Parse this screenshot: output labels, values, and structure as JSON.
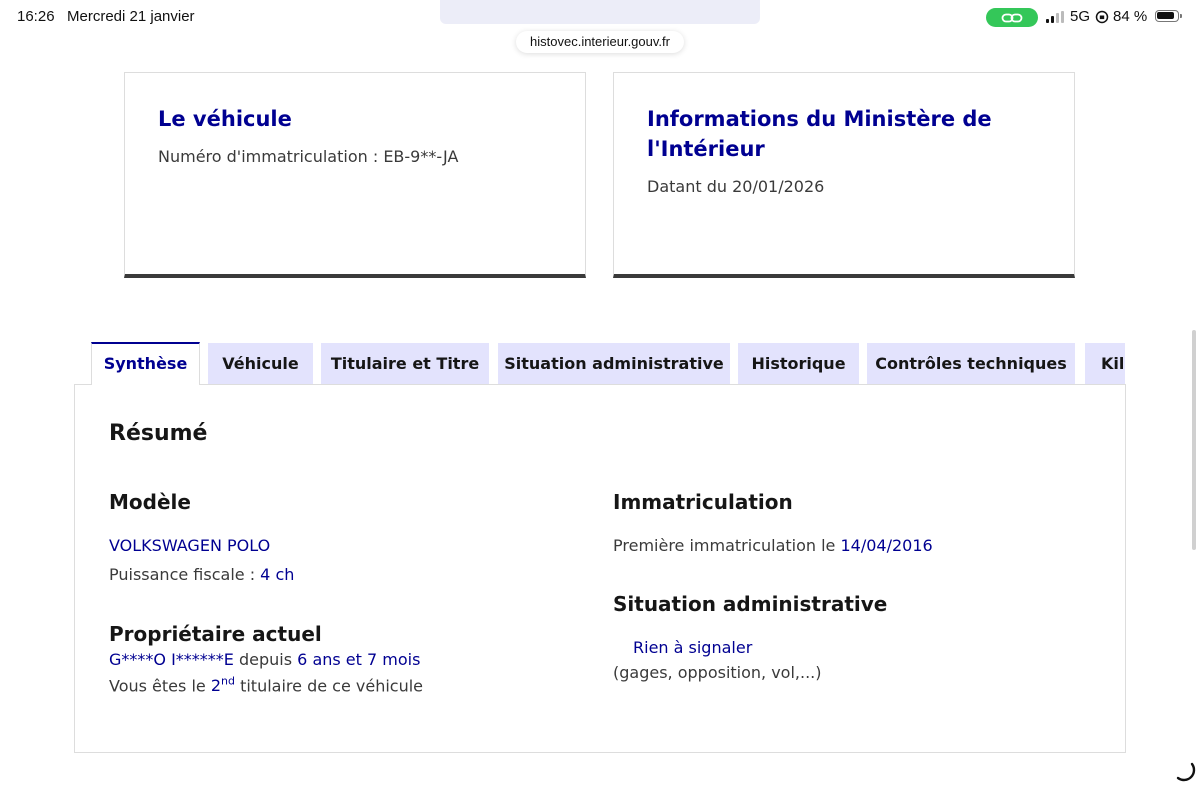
{
  "status_bar": {
    "time": "16:26",
    "date": "Mercredi 21 janvier",
    "network": "5G",
    "battery": "84 %"
  },
  "browser": {
    "url": "histovec.interieur.gouv.fr"
  },
  "cards": {
    "vehicle": {
      "title": "Le véhicule",
      "description": "Numéro d'immatriculation : EB-9**-JA"
    },
    "ministry": {
      "title": "Informations du Ministère de l'Intérieur",
      "description": "Datant du 20/01/2026"
    }
  },
  "tabs": [
    {
      "label": "Synthèse",
      "active": true
    },
    {
      "label": "Véhicule"
    },
    {
      "label": "Titulaire et Titre"
    },
    {
      "label": "Situation administrative"
    },
    {
      "label": "Historique"
    },
    {
      "label": "Contrôles techniques"
    },
    {
      "label": "Kilo"
    }
  ],
  "summary": {
    "title": "Résumé",
    "model": {
      "heading": "Modèle",
      "name": "VOLKSWAGEN POLO",
      "power_label": "Puissance fiscale :",
      "power_value": "4 ch"
    },
    "owner": {
      "heading": "Propriétaire actuel",
      "name": "G****O I******E",
      "since_label": "depuis",
      "duration": "6 ans et 7 mois",
      "rank_prefix": "Vous êtes le",
      "rank_number": "2",
      "rank_suffix": "nd",
      "rank_end": "titulaire de ce véhicule"
    },
    "registration": {
      "heading": "Immatriculation",
      "first_label": "Première immatriculation le",
      "first_date": "14/04/2016"
    },
    "admin": {
      "heading": "Situation administrative",
      "status": "Rien à signaler",
      "details": "(gages, opposition, vol,...)"
    }
  },
  "colors": {
    "primary": "#000091",
    "tab_bg": "#e3e3fd",
    "text": "#3a3a3a",
    "hotspot": "#34c759"
  }
}
